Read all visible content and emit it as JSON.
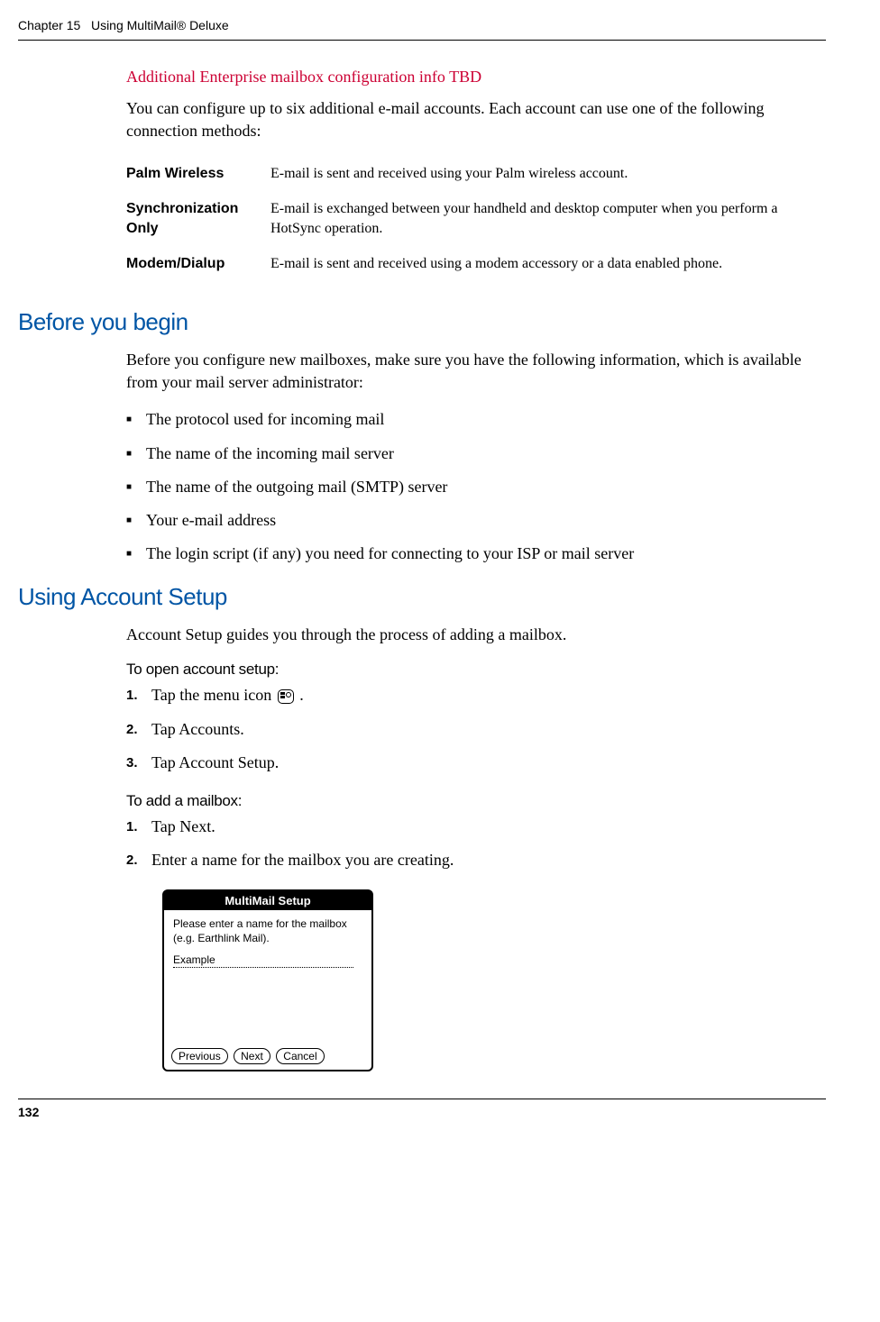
{
  "header": {
    "chapter": "Chapter 15",
    "title": "Using MultiMail® Deluxe"
  },
  "red_heading": "Additional Enterprise mailbox configuration info TBD",
  "intro_paragraph": "You can configure up to six additional e-mail accounts. Each account can use one of the following connection methods:",
  "methods": [
    {
      "label": "Palm Wireless",
      "desc": "E-mail is sent and received using your Palm wireless account."
    },
    {
      "label": "Synchronization Only",
      "desc": "E-mail is exchanged between your handheld and desktop computer when you perform a HotSync operation."
    },
    {
      "label": "Modem/Dialup",
      "desc": "E-mail is sent and received using a modem accessory or a data enabled phone."
    }
  ],
  "section1": {
    "heading": "Before you begin",
    "intro": "Before you configure new mailboxes, make sure you have the following information, which is available from your mail server administrator:",
    "bullets": [
      "The protocol used for incoming mail",
      "The name of the incoming mail server",
      "The name of the outgoing mail (SMTP) server",
      "Your e-mail address",
      "The login script (if any) you need for connecting to your ISP or mail server"
    ]
  },
  "section2": {
    "heading": "Using Account Setup",
    "intro": "Account Setup guides you through the process of adding a mailbox.",
    "sub1_heading": "To open account setup:",
    "sub1_steps": [
      {
        "pre": "Tap the menu icon ",
        "post": " ."
      },
      {
        "pre": "Tap Accounts.",
        "post": ""
      },
      {
        "pre": "Tap Account Setup.",
        "post": ""
      }
    ],
    "sub2_heading": "To add a mailbox:",
    "sub2_steps": [
      "Tap Next.",
      "Enter a name for the mailbox you are creating."
    ]
  },
  "screenshot": {
    "title": "MultiMail Setup",
    "prompt": "Please enter a name for the mailbox (e.g. Earthlink Mail).",
    "input_value": "Example",
    "buttons": [
      "Previous",
      "Next",
      "Cancel"
    ]
  },
  "page_number": "132"
}
